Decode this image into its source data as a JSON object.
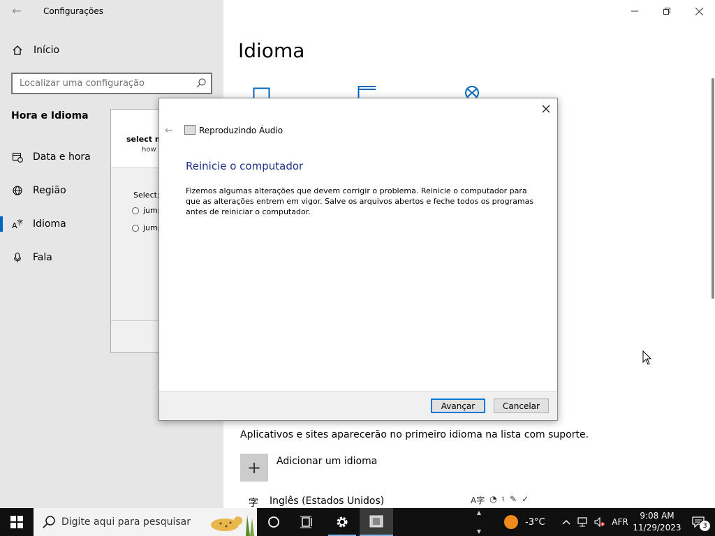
{
  "settings": {
    "app_title": "Configurações",
    "home_label": "Início",
    "search_placeholder": "Localizar uma configuração",
    "section_title": "Hora e Idioma",
    "nav": [
      {
        "label": "Data e hora",
        "icon": "calendar-clock-icon"
      },
      {
        "label": "Região",
        "icon": "globe-icon"
      },
      {
        "label": "Idioma",
        "icon": "language-icon",
        "active": true
      },
      {
        "label": "Fala",
        "icon": "microphone-icon"
      }
    ],
    "main_title": "Idioma",
    "apps_text": "Aplicativos e sites aparecerão no primeiro idioma na lista com suporte.",
    "add_language": "Adicionar um idioma",
    "language_glyph": "字",
    "language_name": "Inglês (Estados Unidos)"
  },
  "background_dialog": {
    "heading": "select m",
    "subheading": "how c",
    "select_label": "Select:",
    "options": [
      "jump",
      "jump"
    ]
  },
  "dialog": {
    "app_title": "Reproduzindo Áudio",
    "heading": "Reinicie o computador",
    "body": "Fizemos algumas alterações que devem corrigir o problema. Reinicie o computador para que as alterações entrem em vigor. Salve os arquivos abertos e feche todos os programas antes de reiniciar o computador.",
    "next_label": "Avançar",
    "cancel_label": "Cancelar"
  },
  "taskbar": {
    "search_placeholder": "Digite aqui para pesquisar",
    "temperature": "-3°C",
    "language": "AFR",
    "time": "9:08 AM",
    "date": "11/29/2023",
    "notification_count": "3"
  },
  "colors": {
    "accent": "#0067c0",
    "dialog_heading": "#1e3287",
    "taskbar": "#101010",
    "sidebar": "#e6e6e6"
  }
}
